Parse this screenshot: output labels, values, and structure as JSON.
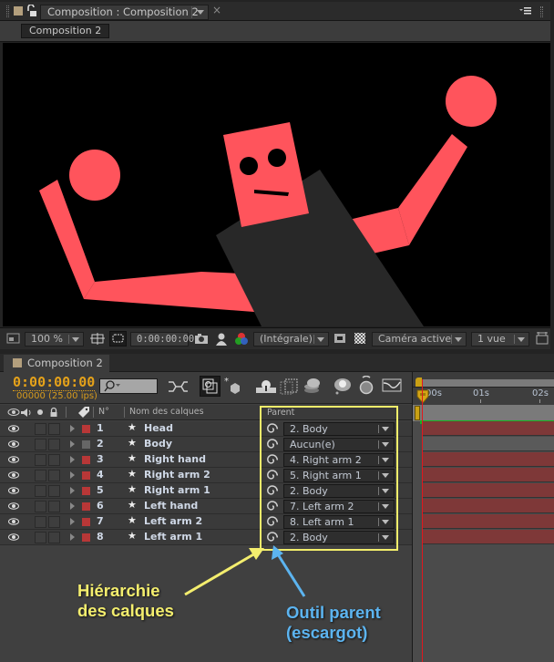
{
  "composition_panel": {
    "tab_title": "Composition : Composition 2",
    "breadcrumb": "Composition 2",
    "label_color": "#b39f7d",
    "viewer_toolbar": {
      "zoom": "100 %",
      "timecode": "0:00:00:00",
      "resolution": "(Intégrale)",
      "camera": "Caméra active",
      "views": "1 vue"
    }
  },
  "character": {
    "limb_color": "#ff545c",
    "body_color": "#282828",
    "background": "#000000"
  },
  "timeline_panel": {
    "tab_title": "Composition 2",
    "current_time": "0:00:00:00",
    "frame_info": "00000 (25.00 ips)",
    "search_placeholder": "",
    "columns": {
      "number": "N°",
      "layer_name": "Nom des calques",
      "parent": "Parent"
    },
    "ruler": [
      "00s",
      "01s",
      "02s"
    ],
    "layers": [
      {
        "number": "1",
        "name": "Head",
        "color": "#b83737",
        "parent": "2. Body"
      },
      {
        "number": "2",
        "name": "Body",
        "color": "#666666",
        "parent": "Aucun(e)"
      },
      {
        "number": "3",
        "name": "Right hand",
        "color": "#b83737",
        "parent": "4. Right arm 2"
      },
      {
        "number": "4",
        "name": "Right arm 2",
        "color": "#b83737",
        "parent": "5. Right arm 1"
      },
      {
        "number": "5",
        "name": "Right arm 1",
        "color": "#b83737",
        "parent": "2. Body"
      },
      {
        "number": "6",
        "name": "Left hand",
        "color": "#b83737",
        "parent": "7. Left arm 2"
      },
      {
        "number": "7",
        "name": "Left arm 2",
        "color": "#b83737",
        "parent": "8. Left arm 1"
      },
      {
        "number": "8",
        "name": "Left arm 1",
        "color": "#b83737",
        "parent": "2. Body"
      }
    ]
  },
  "annotations": {
    "hierarchy": {
      "line1": "Hiérarchie",
      "line2": "des calques",
      "color": "#f4ee6e"
    },
    "parent_tool": {
      "line1": "Outil parent",
      "line2": "(escargot)",
      "color": "#5cb4f0"
    }
  }
}
